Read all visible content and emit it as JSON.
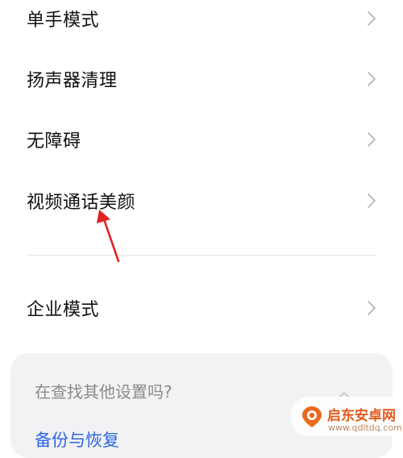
{
  "settings": {
    "items": [
      {
        "label": "单手模式"
      },
      {
        "label": "扬声器清理"
      },
      {
        "label": "无障碍"
      },
      {
        "label": "视频通话美颜"
      },
      {
        "label": "企业模式"
      }
    ]
  },
  "search_card": {
    "title": "在查找其他设置吗?",
    "link": "备份与恢复"
  },
  "watermark": {
    "name": "启东安卓网",
    "url": "www.qdltdq.com"
  },
  "colors": {
    "text": "#111111",
    "chevron": "#b3b3b3",
    "arrow": "#e02222",
    "card": "#f2f2f4",
    "link": "#2b66e0",
    "watermark": "#e15a1c"
  },
  "icons": {
    "chevron": "chevron-right-icon",
    "annotation": "red-arrow-icon",
    "collapse": "chevron-up-icon",
    "watermark_logo": "pin-logo-icon"
  }
}
